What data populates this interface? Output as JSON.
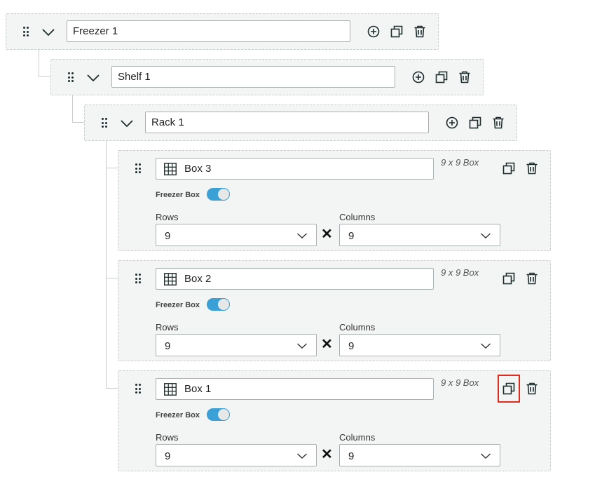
{
  "freezer": {
    "name": "Freezer 1"
  },
  "shelf": {
    "name": "Shelf 1"
  },
  "rack": {
    "name": "Rack 1"
  },
  "boxes": [
    {
      "name": "Box 3",
      "dims": "9 x 9 Box",
      "freezer_label": "Freezer Box",
      "freezer_box": true,
      "rows_label": "Rows",
      "rows": "9",
      "columns_label": "Columns",
      "columns": "9"
    },
    {
      "name": "Box 2",
      "dims": "9 x 9 Box",
      "freezer_label": "Freezer Box",
      "freezer_box": true,
      "rows_label": "Rows",
      "rows": "9",
      "columns_label": "Columns",
      "columns": "9"
    },
    {
      "name": "Box 1",
      "dims": "9 x 9 Box",
      "freezer_label": "Freezer Box",
      "freezer_box": true,
      "rows_label": "Rows",
      "rows": "9",
      "columns_label": "Columns",
      "columns": "9"
    }
  ],
  "colors": {
    "accent": "#3aa0d6",
    "highlight": "#e02b20",
    "panel": "#f3f4f4"
  },
  "icons": [
    "drag-handle-icon",
    "chevron-down-icon",
    "add-circle-icon",
    "copy-icon",
    "trash-icon",
    "grid-icon",
    "multiply-icon"
  ]
}
